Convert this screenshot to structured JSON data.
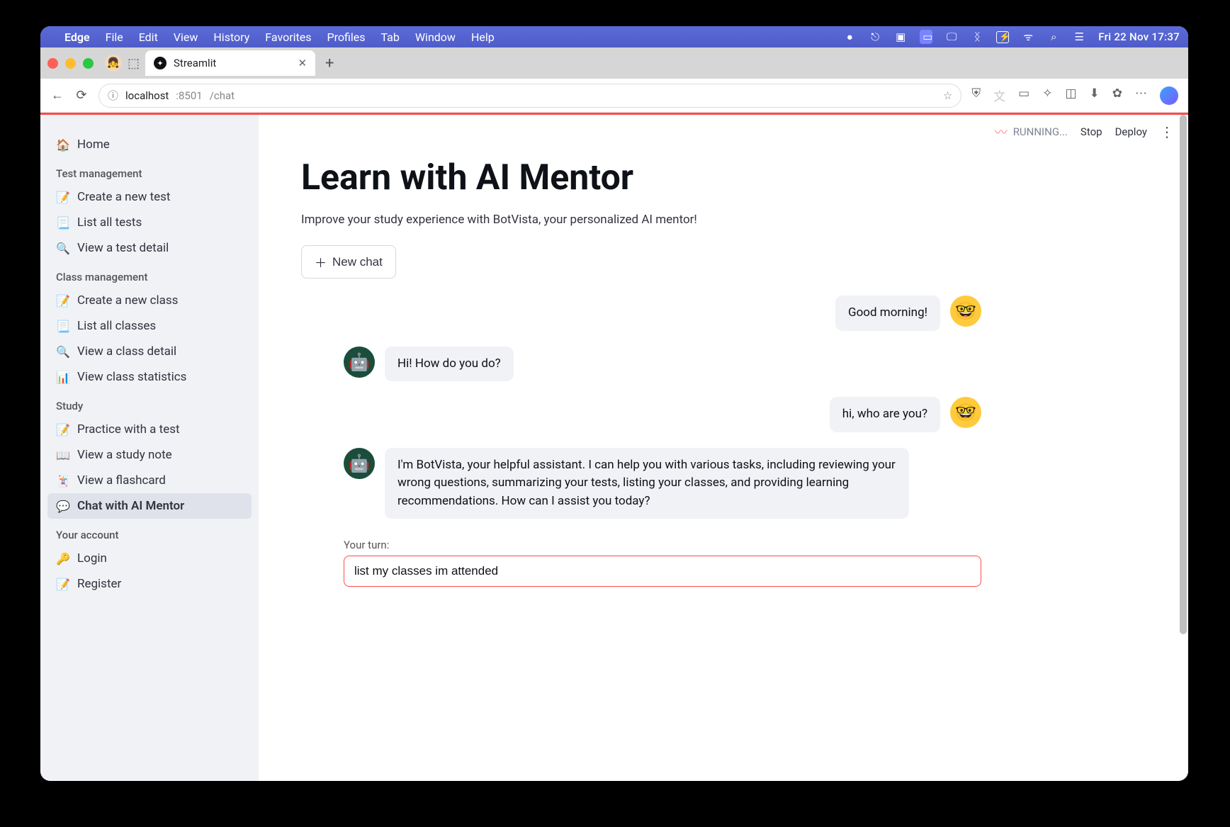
{
  "menubar": {
    "app": "Edge",
    "items": [
      "File",
      "Edit",
      "View",
      "History",
      "Favorites",
      "Profiles",
      "Tab",
      "Window",
      "Help"
    ],
    "clock": "Fri 22 Nov  17:37"
  },
  "tab": {
    "title": "Streamlit"
  },
  "url": {
    "host": "localhost",
    "port": ":8501",
    "path": "/chat"
  },
  "topbar": {
    "running": "RUNNING...",
    "stop": "Stop",
    "deploy": "Deploy"
  },
  "sidebar": {
    "home": "Home",
    "sections": [
      {
        "title": "Test management",
        "items": [
          {
            "icon": "📝",
            "label": "Create a new test"
          },
          {
            "icon": "📃",
            "label": "List all tests"
          },
          {
            "icon": "🔍",
            "label": "View a test detail"
          }
        ]
      },
      {
        "title": "Class management",
        "items": [
          {
            "icon": "📝",
            "label": "Create a new class"
          },
          {
            "icon": "📃",
            "label": "List all classes"
          },
          {
            "icon": "🔍",
            "label": "View a class detail"
          },
          {
            "icon": "📊",
            "label": "View class statistics"
          }
        ]
      },
      {
        "title": "Study",
        "items": [
          {
            "icon": "📝",
            "label": "Practice with a test"
          },
          {
            "icon": "📖",
            "label": "View a study note"
          },
          {
            "icon": "🃏",
            "label": "View a flashcard"
          },
          {
            "icon": "💬",
            "label": "Chat with AI Mentor",
            "active": true
          }
        ]
      },
      {
        "title": "Your account",
        "items": [
          {
            "icon": "🔑",
            "label": "Login"
          },
          {
            "icon": "📝",
            "label": "Register"
          }
        ]
      }
    ]
  },
  "page": {
    "title": "Learn with AI Mentor",
    "subtitle": "Improve your study experience with BotVista, your personalized AI mentor!",
    "newchat": "New chat"
  },
  "chat": {
    "messages": [
      {
        "role": "user",
        "text": "Good morning!"
      },
      {
        "role": "bot",
        "text": "Hi! How do you do?"
      },
      {
        "role": "user",
        "text": "hi, who are you?"
      },
      {
        "role": "bot",
        "text": "I'm BotVista, your helpful assistant. I can help you with various tasks, including reviewing your wrong questions, summarizing your tests, listing your classes, and providing learning recommendations. How can I assist you today?"
      }
    ],
    "input_label": "Your turn:",
    "input_value": "list my classes im attended"
  }
}
